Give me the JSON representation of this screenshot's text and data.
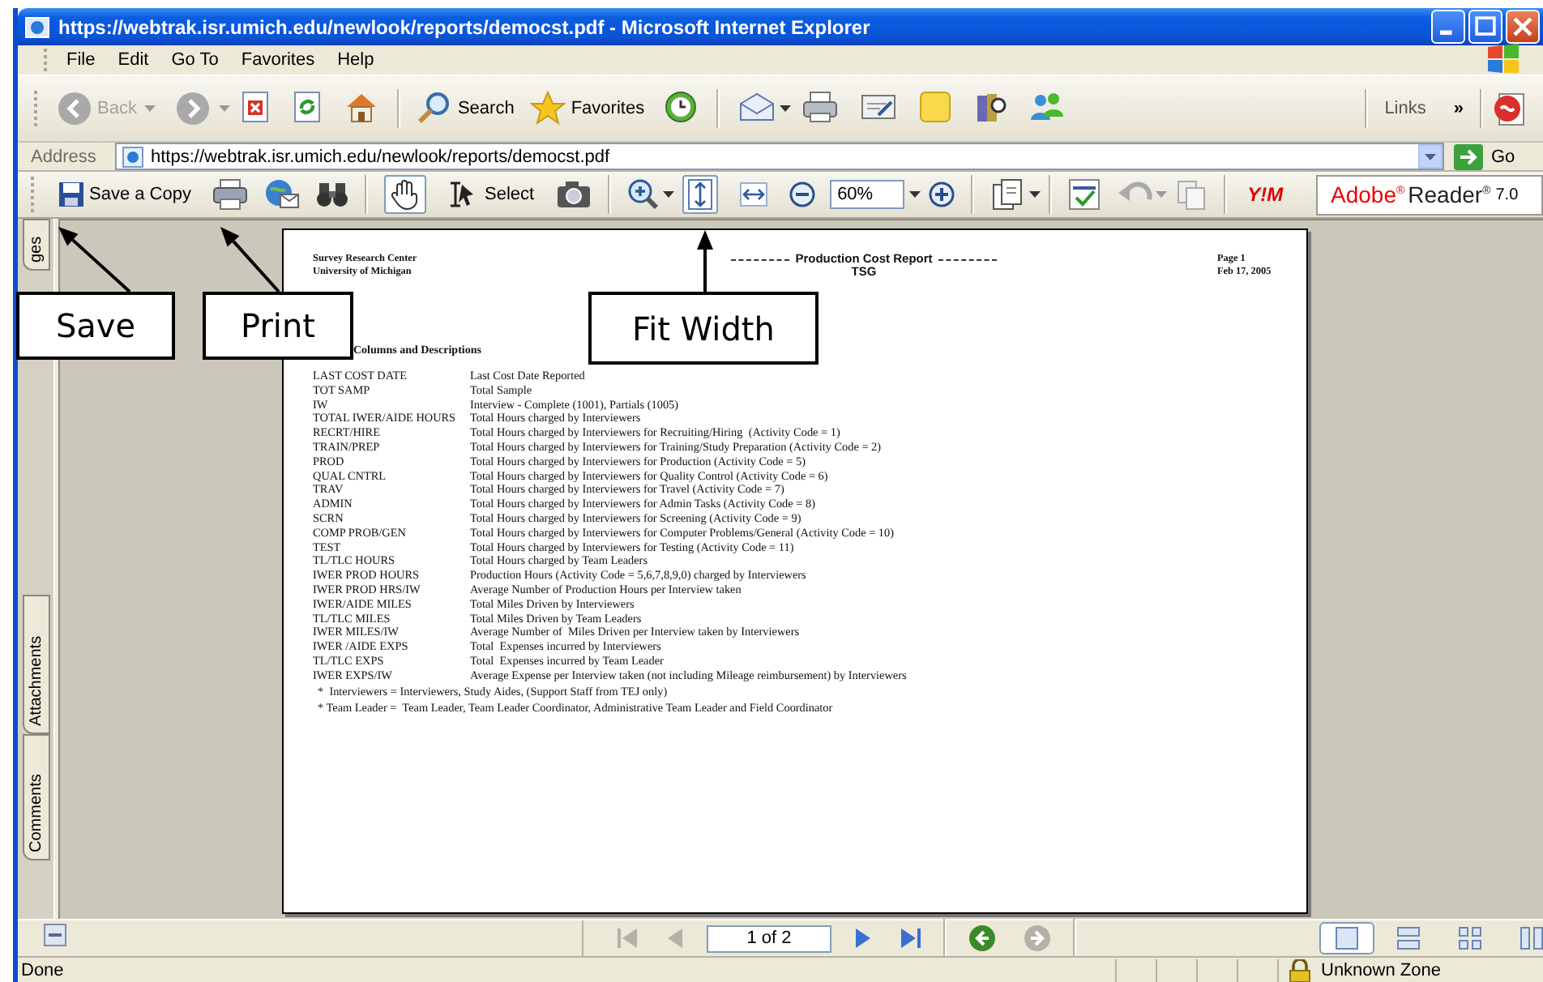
{
  "window": {
    "title": "https://webtrak.isr.umich.edu/newlook/reports/democst.pdf - Microsoft Internet Explorer"
  },
  "menu": [
    "File",
    "Edit",
    "Go To",
    "Favorites",
    "Help"
  ],
  "toolbar": {
    "back": {
      "label": "Back",
      "disabled": true
    },
    "forward": {
      "disabled": true
    },
    "search": "Search",
    "favorites": "Favorites",
    "links": "Links",
    "links_more": "»"
  },
  "address": {
    "label": "Address",
    "value": "https://webtrak.isr.umich.edu/newlook/reports/democst.pdf",
    "go": "Go"
  },
  "reader_toolbar": {
    "save_copy": "Save a Copy",
    "hand_tool": {
      "selected": true
    },
    "select_tool": {
      "label": "Select",
      "selected": false
    },
    "fit_page": {
      "selected": true
    },
    "fit_width": {
      "selected": false
    },
    "zoom": "60%",
    "messenger_logo": "Y!M",
    "brand": {
      "name": "Adobe$^{®}$",
      "product": "Reader$^{®}$",
      "version": "7.0"
    }
  },
  "side_tabs": [
    {
      "label": "ges"
    },
    {
      "label": "Attachments"
    },
    {
      "label": "Comments"
    }
  ],
  "document": {
    "org": [
      "Survey Research Center",
      "University of Michigan"
    ],
    "title": "Production Cost Report",
    "subtitle": "TSG",
    "page": "Page 1",
    "date": "Feb 17, 2005",
    "section": "Columns and Descriptions",
    "rows": [
      {
        "term": "LAST COST DATE",
        "description": "Last Cost Date Reported"
      },
      {
        "term": "TOT SAMP",
        "description": "Total Sample"
      },
      {
        "term": "IW",
        "description": "Interview - Complete (1001), Partials (1005)"
      },
      {
        "term": "TOTAL IWER/AIDE HOURS",
        "description": "Total Hours charged by Interviewers"
      },
      {
        "term": "RECRT/HIRE",
        "description": "Total Hours charged by Interviewers for Recruiting/Hiring  (Activity Code = 1)"
      },
      {
        "term": "TRAIN/PREP",
        "description": "Total Hours charged by Interviewers for Training/Study Preparation (Activity Code = 2)"
      },
      {
        "term": "PROD",
        "description": "Total Hours charged by Interviewers for Production (Activity Code = 5)"
      },
      {
        "term": "QUAL CNTRL",
        "description": "Total Hours charged by Interviewers for Quality Control (Activity Code = 6)"
      },
      {
        "term": "TRAV",
        "description": "Total Hours charged by Interviewers for Travel (Activity Code = 7)"
      },
      {
        "term": "ADMIN",
        "description": "Total Hours charged by Interviewers for Admin Tasks (Activity Code = 8)"
      },
      {
        "term": "SCRN",
        "description": "Total Hours charged by Interviewers for Screening (Activity Code = 9)"
      },
      {
        "term": "COMP PROB/GEN",
        "description": "Total Hours charged by Interviewers for Computer Problems/General (Activity Code = 10)"
      },
      {
        "term": "TEST",
        "description": "Total Hours charged by Interviewers for Testing (Activity Code = 11)"
      },
      {
        "term": "TL/TLC HOURS",
        "description": "Total Hours charged by Team Leaders"
      },
      {
        "term": "IWER PROD HOURS",
        "description": "Production Hours (Activity Code = 5,6,7,8,9,0) charged by Interviewers"
      },
      {
        "term": "IWER PROD HRS/IW",
        "description": "Average Number of Production Hours per Interview taken"
      },
      {
        "term": "IWER/AIDE MILES",
        "description": "Total Miles Driven by Interviewers"
      },
      {
        "term": "TL/TLC MILES",
        "description": "Total Miles Driven by Team Leaders"
      },
      {
        "term": "IWER MILES/IW",
        "description": "Average Number of  Miles Driven per Interview taken by Interviewers"
      },
      {
        "term": "IWER /AIDE EXPS",
        "description": "Total  Expenses incurred by Interviewers"
      },
      {
        "term": "TL/TLC EXPS",
        "description": "Total  Expenses incurred by Team Leader"
      },
      {
        "term": "IWER EXPS/IW",
        "description": "Average Expense per Interview taken (not including Mileage reimbursement) by Interviewers"
      }
    ],
    "notes": [
      "*  Interviewers = Interviewers, Study Aides, (Support Staff from TEJ only)",
      "* Team Leader =  Team Leader, Team Leader Coordinator, Administrative Team Leader and Field Coordinator"
    ]
  },
  "navigation": {
    "first": {
      "disabled": true
    },
    "previous": {
      "disabled": true
    },
    "page": "1 of 2",
    "next": {
      "disabled": false
    },
    "last": {
      "disabled": false
    },
    "back": {
      "disabled": false
    },
    "forward": {
      "disabled": true
    },
    "layouts": [
      {
        "selected": true
      },
      {
        "selected": false
      },
      {
        "selected": false
      },
      {
        "selected": false
      }
    ]
  },
  "status": {
    "text": "Done",
    "zone": "Unknown Zone"
  },
  "callouts": [
    {
      "label": "Save"
    },
    {
      "label": "Print"
    },
    {
      "label": "Fit Width"
    }
  ]
}
